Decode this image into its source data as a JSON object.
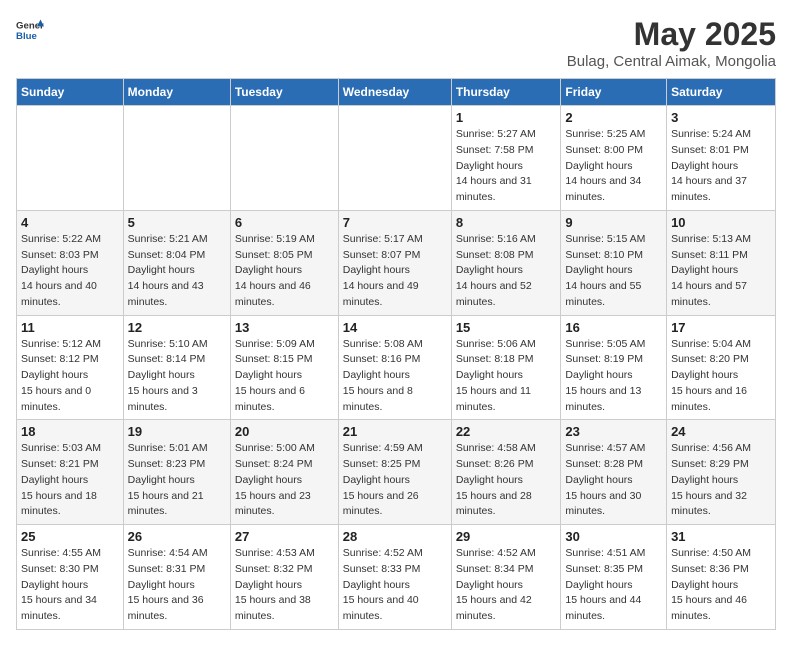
{
  "header": {
    "logo_general": "General",
    "logo_blue": "Blue",
    "title": "May 2025",
    "subtitle": "Bulag, Central Aimak, Mongolia"
  },
  "days_of_week": [
    "Sunday",
    "Monday",
    "Tuesday",
    "Wednesday",
    "Thursday",
    "Friday",
    "Saturday"
  ],
  "weeks": [
    [
      {
        "day": "",
        "sunrise": "",
        "sunset": "",
        "daylight": ""
      },
      {
        "day": "",
        "sunrise": "",
        "sunset": "",
        "daylight": ""
      },
      {
        "day": "",
        "sunrise": "",
        "sunset": "",
        "daylight": ""
      },
      {
        "day": "",
        "sunrise": "",
        "sunset": "",
        "daylight": ""
      },
      {
        "day": "1",
        "sunrise": "5:27 AM",
        "sunset": "7:58 PM",
        "daylight": "14 hours and 31 minutes."
      },
      {
        "day": "2",
        "sunrise": "5:25 AM",
        "sunset": "8:00 PM",
        "daylight": "14 hours and 34 minutes."
      },
      {
        "day": "3",
        "sunrise": "5:24 AM",
        "sunset": "8:01 PM",
        "daylight": "14 hours and 37 minutes."
      }
    ],
    [
      {
        "day": "4",
        "sunrise": "5:22 AM",
        "sunset": "8:03 PM",
        "daylight": "14 hours and 40 minutes."
      },
      {
        "day": "5",
        "sunrise": "5:21 AM",
        "sunset": "8:04 PM",
        "daylight": "14 hours and 43 minutes."
      },
      {
        "day": "6",
        "sunrise": "5:19 AM",
        "sunset": "8:05 PM",
        "daylight": "14 hours and 46 minutes."
      },
      {
        "day": "7",
        "sunrise": "5:17 AM",
        "sunset": "8:07 PM",
        "daylight": "14 hours and 49 minutes."
      },
      {
        "day": "8",
        "sunrise": "5:16 AM",
        "sunset": "8:08 PM",
        "daylight": "14 hours and 52 minutes."
      },
      {
        "day": "9",
        "sunrise": "5:15 AM",
        "sunset": "8:10 PM",
        "daylight": "14 hours and 55 minutes."
      },
      {
        "day": "10",
        "sunrise": "5:13 AM",
        "sunset": "8:11 PM",
        "daylight": "14 hours and 57 minutes."
      }
    ],
    [
      {
        "day": "11",
        "sunrise": "5:12 AM",
        "sunset": "8:12 PM",
        "daylight": "15 hours and 0 minutes."
      },
      {
        "day": "12",
        "sunrise": "5:10 AM",
        "sunset": "8:14 PM",
        "daylight": "15 hours and 3 minutes."
      },
      {
        "day": "13",
        "sunrise": "5:09 AM",
        "sunset": "8:15 PM",
        "daylight": "15 hours and 6 minutes."
      },
      {
        "day": "14",
        "sunrise": "5:08 AM",
        "sunset": "8:16 PM",
        "daylight": "15 hours and 8 minutes."
      },
      {
        "day": "15",
        "sunrise": "5:06 AM",
        "sunset": "8:18 PM",
        "daylight": "15 hours and 11 minutes."
      },
      {
        "day": "16",
        "sunrise": "5:05 AM",
        "sunset": "8:19 PM",
        "daylight": "15 hours and 13 minutes."
      },
      {
        "day": "17",
        "sunrise": "5:04 AM",
        "sunset": "8:20 PM",
        "daylight": "15 hours and 16 minutes."
      }
    ],
    [
      {
        "day": "18",
        "sunrise": "5:03 AM",
        "sunset": "8:21 PM",
        "daylight": "15 hours and 18 minutes."
      },
      {
        "day": "19",
        "sunrise": "5:01 AM",
        "sunset": "8:23 PM",
        "daylight": "15 hours and 21 minutes."
      },
      {
        "day": "20",
        "sunrise": "5:00 AM",
        "sunset": "8:24 PM",
        "daylight": "15 hours and 23 minutes."
      },
      {
        "day": "21",
        "sunrise": "4:59 AM",
        "sunset": "8:25 PM",
        "daylight": "15 hours and 26 minutes."
      },
      {
        "day": "22",
        "sunrise": "4:58 AM",
        "sunset": "8:26 PM",
        "daylight": "15 hours and 28 minutes."
      },
      {
        "day": "23",
        "sunrise": "4:57 AM",
        "sunset": "8:28 PM",
        "daylight": "15 hours and 30 minutes."
      },
      {
        "day": "24",
        "sunrise": "4:56 AM",
        "sunset": "8:29 PM",
        "daylight": "15 hours and 32 minutes."
      }
    ],
    [
      {
        "day": "25",
        "sunrise": "4:55 AM",
        "sunset": "8:30 PM",
        "daylight": "15 hours and 34 minutes."
      },
      {
        "day": "26",
        "sunrise": "4:54 AM",
        "sunset": "8:31 PM",
        "daylight": "15 hours and 36 minutes."
      },
      {
        "day": "27",
        "sunrise": "4:53 AM",
        "sunset": "8:32 PM",
        "daylight": "15 hours and 38 minutes."
      },
      {
        "day": "28",
        "sunrise": "4:52 AM",
        "sunset": "8:33 PM",
        "daylight": "15 hours and 40 minutes."
      },
      {
        "day": "29",
        "sunrise": "4:52 AM",
        "sunset": "8:34 PM",
        "daylight": "15 hours and 42 minutes."
      },
      {
        "day": "30",
        "sunrise": "4:51 AM",
        "sunset": "8:35 PM",
        "daylight": "15 hours and 44 minutes."
      },
      {
        "day": "31",
        "sunrise": "4:50 AM",
        "sunset": "8:36 PM",
        "daylight": "15 hours and 46 minutes."
      }
    ]
  ],
  "labels": {
    "sunrise": "Sunrise:",
    "sunset": "Sunset:",
    "daylight": "Daylight hours"
  }
}
